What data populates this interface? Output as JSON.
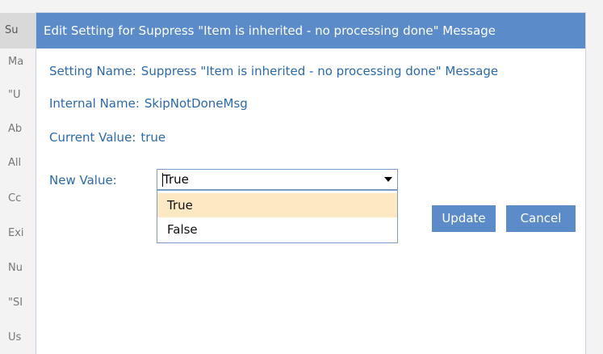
{
  "background": {
    "header_label": "Su",
    "rows": [
      "Ma",
      "\"U",
      "Ab",
      "All",
      "Cc",
      "Exi",
      "Nu",
      "\"SI",
      "Us"
    ]
  },
  "dialog": {
    "title": "Edit Setting for Suppress \"Item is inherited - no processing done\" Message",
    "setting_name_label": "Setting Name:",
    "setting_name_value": "Suppress \"Item is inherited - no processing done\" Message",
    "internal_name_label": "Internal Name:",
    "internal_name_value": "SkipNotDoneMsg",
    "current_value_label": "Current Value:",
    "current_value_value": "true",
    "new_value_label": "New Value:",
    "new_value_selected": "True",
    "options": [
      "True",
      "False"
    ],
    "update_label": "Update",
    "cancel_label": "Cancel"
  },
  "colors": {
    "accent": "#5b8bc9",
    "label_text": "#2a6aab",
    "highlight": "#fce9c3"
  }
}
